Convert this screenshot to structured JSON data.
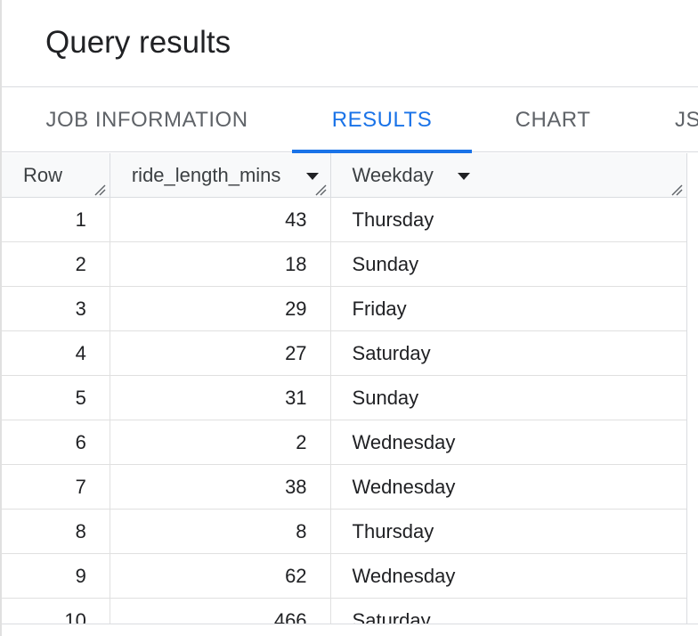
{
  "header": {
    "title": "Query results"
  },
  "tabs": [
    {
      "label": "JOB INFORMATION",
      "active": false
    },
    {
      "label": "RESULTS",
      "active": true
    },
    {
      "label": "CHART",
      "active": false
    },
    {
      "label": "JS",
      "active": false
    }
  ],
  "table": {
    "columns": [
      "Row",
      "ride_length_mins",
      "Weekday"
    ],
    "rows": [
      {
        "row": "1",
        "ride_length_mins": "43",
        "weekday": "Thursday"
      },
      {
        "row": "2",
        "ride_length_mins": "18",
        "weekday": "Sunday"
      },
      {
        "row": "3",
        "ride_length_mins": "29",
        "weekday": "Friday"
      },
      {
        "row": "4",
        "ride_length_mins": "27",
        "weekday": "Saturday"
      },
      {
        "row": "5",
        "ride_length_mins": "31",
        "weekday": "Sunday"
      },
      {
        "row": "6",
        "ride_length_mins": "2",
        "weekday": "Wednesday"
      },
      {
        "row": "7",
        "ride_length_mins": "38",
        "weekday": "Wednesday"
      },
      {
        "row": "8",
        "ride_length_mins": "8",
        "weekday": "Thursday"
      },
      {
        "row": "9",
        "ride_length_mins": "62",
        "weekday": "Wednesday"
      },
      {
        "row": "10",
        "ride_length_mins": "466",
        "weekday": "Saturday"
      }
    ]
  },
  "colors": {
    "accent": "#1a73e8",
    "text": "#202124",
    "muted": "#5f6368",
    "border": "#dadce0"
  }
}
